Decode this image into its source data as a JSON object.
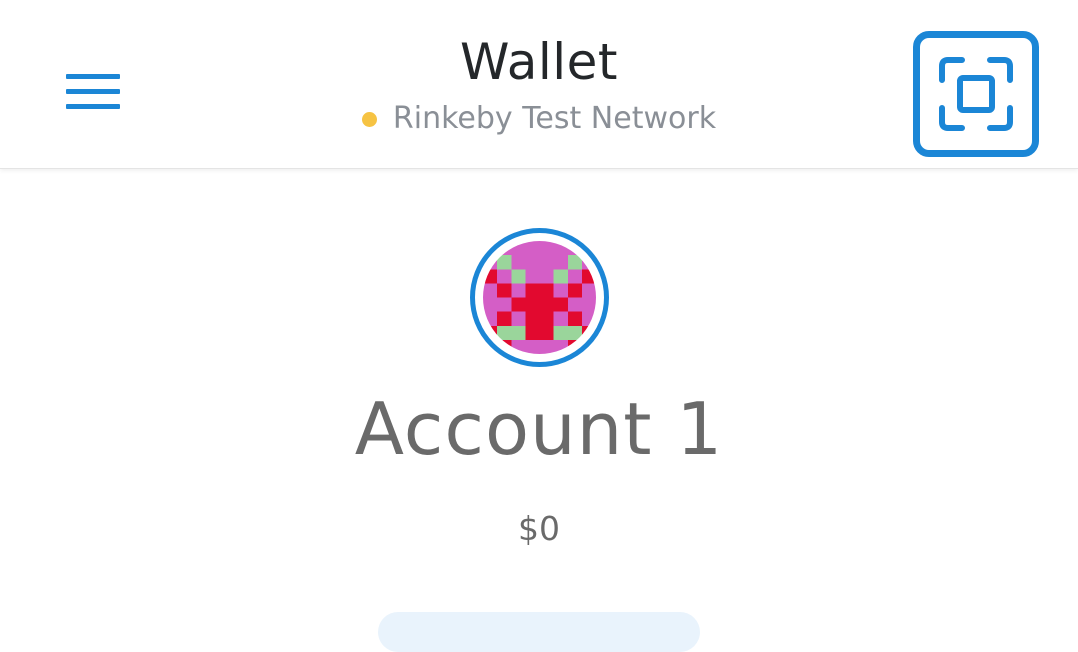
{
  "header": {
    "title": "Wallet",
    "network_name": "Rinkeby Test Network",
    "network_status_color": "#f6c343"
  },
  "icons": {
    "menu": "hamburger-menu-icon",
    "scan": "qr-scan-icon"
  },
  "colors": {
    "accent": "#1b86d6",
    "identicon_bg": "#d45ec6",
    "identicon_primary": "#e2092f",
    "identicon_secondary": "#9ad59b"
  },
  "account": {
    "name": "Account 1",
    "balance": "$0"
  }
}
